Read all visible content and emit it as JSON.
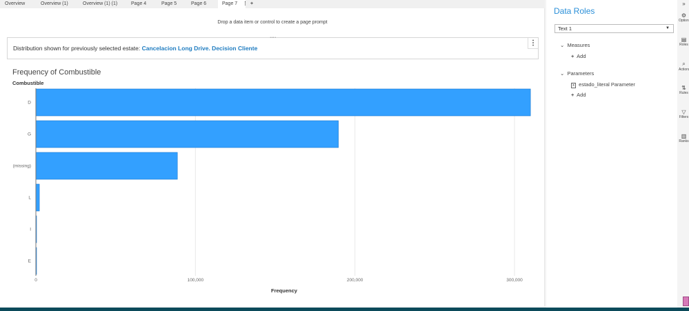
{
  "tabs": [
    {
      "label": "Overview"
    },
    {
      "label": "Overview (1)"
    },
    {
      "label": "Overview (1) (1)"
    },
    {
      "label": "Page 4"
    },
    {
      "label": "Page 5"
    },
    {
      "label": "Page 6"
    },
    {
      "label": "Page 7",
      "active": true
    }
  ],
  "tab_more": "⋮",
  "tab_add": "+",
  "prompt": "Drop a data item or control to create a page prompt",
  "textbox": {
    "prefix": "Distribution shown for previously selected estate: ",
    "value": "Cancelacion Long Drive. Decision Cliente",
    "menu": "⋮",
    "grip": "····"
  },
  "chart_data": {
    "type": "bar",
    "orientation": "horizontal",
    "title": "Frequency of Combustible",
    "ylabel": "Combustible",
    "xlabel": "Frequency",
    "categories": [
      "D",
      "G",
      "(missing)",
      "L",
      "I",
      "E"
    ],
    "values": [
      310000,
      189600,
      88700,
      2200,
      400,
      100
    ],
    "xlim": [
      0,
      316000
    ],
    "xticks": [
      0,
      100000,
      200000,
      300000
    ],
    "xtick_labels": [
      "0",
      "100,000",
      "200,000",
      "300,000"
    ],
    "grid": true,
    "bar_color": "#33a0ff"
  },
  "panel": {
    "title": "Data Roles",
    "select": "Text 1",
    "measures": "Measures",
    "add": "Add",
    "parameters": "Parameters",
    "param_item": "estado_literal Parameter",
    "param_icon": "x"
  },
  "rail": [
    {
      "label": "Options",
      "icon": "⚙"
    },
    {
      "label": "Roles",
      "icon": "▤"
    },
    {
      "label": "Actions",
      "icon": "⌕"
    },
    {
      "label": "Rules",
      "icon": "⇅"
    },
    {
      "label": "Filters",
      "icon": "▽"
    },
    {
      "label": "Ranks",
      "icon": "▥"
    }
  ],
  "rail_collapse": "»"
}
